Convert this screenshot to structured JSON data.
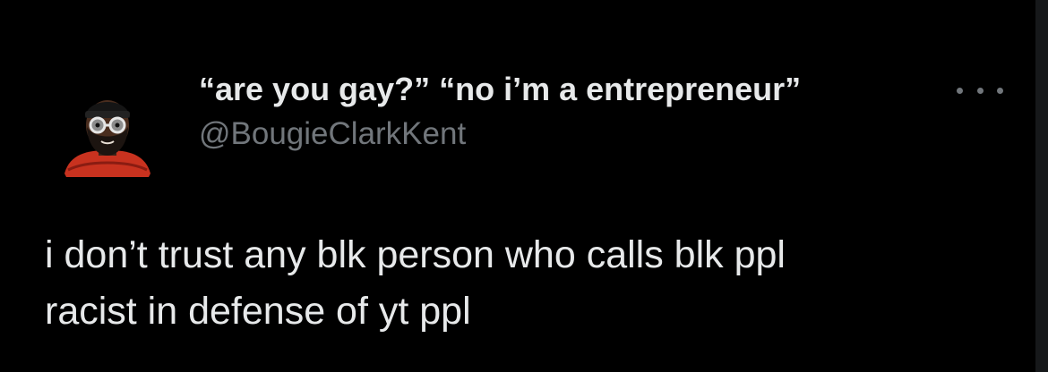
{
  "tweet": {
    "display_name": "“are you gay?” “no i’m a entrepreneur”",
    "handle": "@BougieClarkKent",
    "text_lines": [
      "i don’t trust any blk person who calls blk ppl",
      "racist in defense of yt ppl"
    ],
    "avatar": "memoji-avatar-bearded-glasses-icon",
    "more_icon": "more-options-icon"
  },
  "colors": {
    "background": "#000000",
    "primary_text": "#e7e9ea",
    "secondary_text": "#71767b"
  }
}
